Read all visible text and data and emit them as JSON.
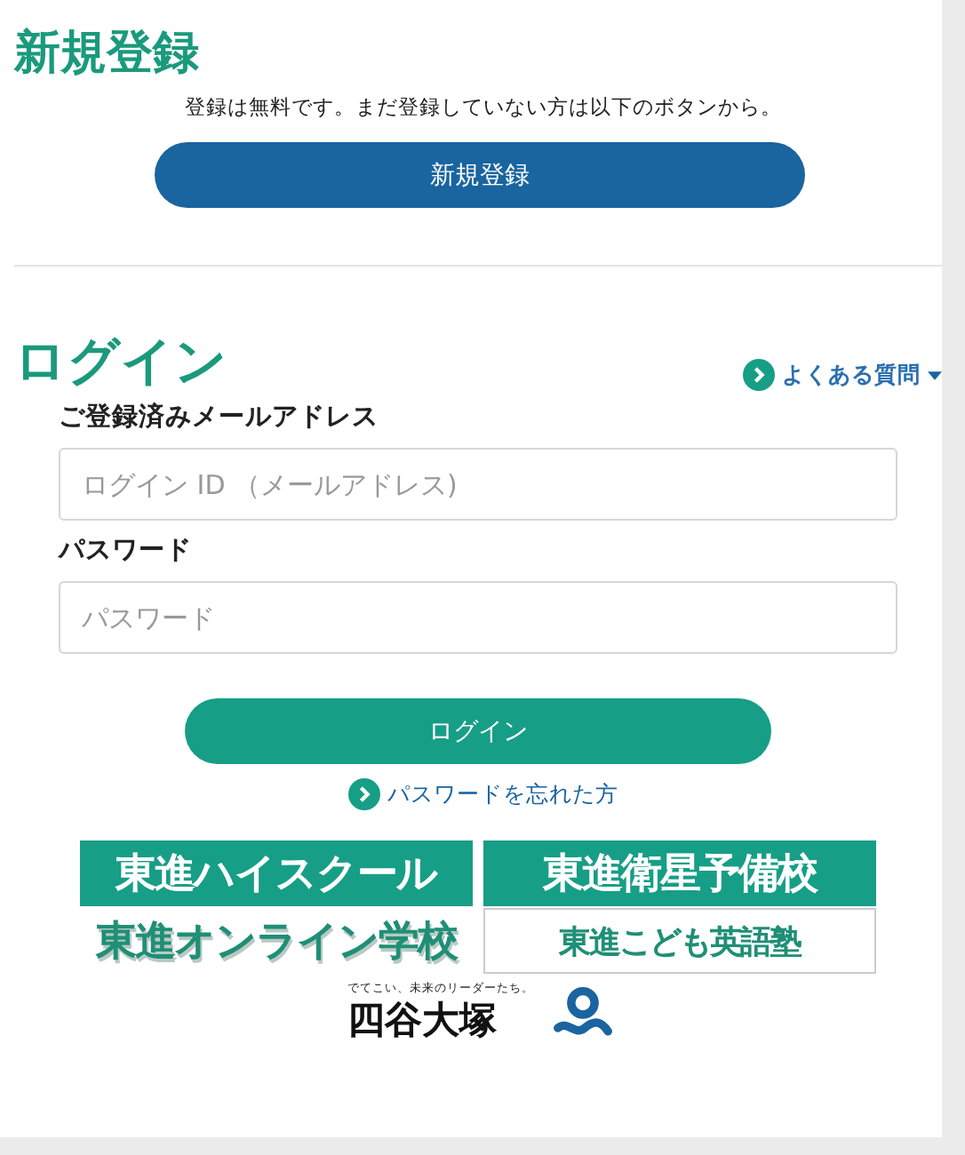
{
  "signup": {
    "title": "新規登録",
    "description": "登録は無料です。まだ登録していない方は以下のボタンから。",
    "button": "新規登録"
  },
  "login": {
    "title": "ログイン",
    "faq_link": "よくある質問",
    "email_label": "ご登録済みメールアドレス",
    "email_placeholder": "ログイン ID （メールアドレス)",
    "password_label": "パスワード",
    "password_placeholder": "パスワード",
    "button": "ログイン",
    "forgot_link": "パスワードを忘れた方"
  },
  "logos": [
    {
      "text": "東進ハイスクール",
      "kind": "filled"
    },
    {
      "text": "東進衛星予備校",
      "kind": "filled"
    },
    {
      "text": "東進オンライン学校",
      "kind": "shadow"
    },
    {
      "text": "東進こども英語塾",
      "kind": "outlined"
    }
  ],
  "yotsuya": {
    "tagline": "でてこい、未来のリーダーたち。",
    "name": "四谷大塚"
  }
}
